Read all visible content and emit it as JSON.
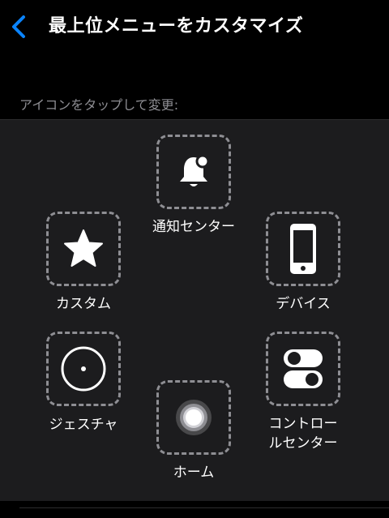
{
  "nav": {
    "back_icon": "chevron-left-icon",
    "title": "最上位メニューをカスタマイズ"
  },
  "section": {
    "label": "アイコンをタップして変更:"
  },
  "items": [
    {
      "id": "notification-center",
      "label": "通知センター",
      "icon": "bell-icon"
    },
    {
      "id": "custom",
      "label": "カスタム",
      "icon": "star-icon"
    },
    {
      "id": "device",
      "label": "デバイス",
      "icon": "iphone-icon"
    },
    {
      "id": "gesture",
      "label": "ジェスチャ",
      "icon": "gesture-circle-icon"
    },
    {
      "id": "control-center",
      "label_line1": "コントロー",
      "label_line2": "ルセンター",
      "icon": "toggles-icon"
    },
    {
      "id": "home",
      "label": "ホーム",
      "icon": "home-button-icon"
    }
  ],
  "colors": {
    "accent": "#0a84ff",
    "background": "#000000",
    "panel": "#1c1c1e",
    "dashed_border": "#8e8e93",
    "secondary_text": "#8e8e93"
  }
}
